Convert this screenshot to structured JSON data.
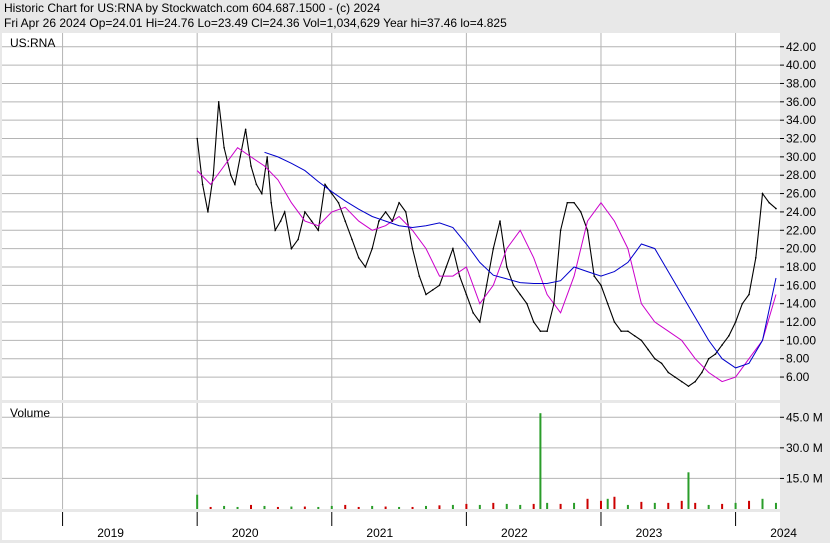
{
  "header": {
    "title": "Historic Chart for US:RNA by Stockwatch.com 604.687.1500 - (c) 2024",
    "summary": "Fri Apr 26 2024   Op=24.01  Hi=24.76  Lo=23.49  Cl=24.36  Vol=1,034,629  Year hi=37.46  lo=4.825"
  },
  "colors": {
    "price": "#000000",
    "ma_short": "#cc00cc",
    "ma_long": "#0000cc",
    "vol_up": "#2a9d2a",
    "vol_down": "#cc0000",
    "grid": "#b4b4b4",
    "panel": "#ffffff",
    "frame": "#e8e8e8"
  },
  "chart_data": [
    {
      "type": "line",
      "panel_label": "US:RNA",
      "y_ticks": [
        "42.00",
        "40.00",
        "38.00",
        "36.00",
        "34.00",
        "32.00",
        "30.00",
        "28.00",
        "26.00",
        "24.00",
        "22.00",
        "20.00",
        "18.00",
        "16.00",
        "14.00",
        "12.00",
        "10.00",
        "8.00",
        "6.00"
      ],
      "ylim": [
        3.5,
        43.5
      ],
      "x_ticks": [
        "2019",
        "2020",
        "2021",
        "2022",
        "2023",
        "2024"
      ],
      "x_tick_values": [
        2019.0,
        2020.0,
        2021.0,
        2022.0,
        2023.0,
        2024.0
      ],
      "xlim": [
        2018.55,
        2024.33
      ],
      "grid": true,
      "series": [
        {
          "role": "price",
          "x": [
            2020.0,
            2020.04,
            2020.08,
            2020.12,
            2020.16,
            2020.2,
            2020.25,
            2020.28,
            2020.32,
            2020.36,
            2020.4,
            2020.44,
            2020.48,
            2020.52,
            2020.55,
            2020.58,
            2020.62,
            2020.65,
            2020.7,
            2020.75,
            2020.8,
            2020.85,
            2020.9,
            2020.95,
            2021.0,
            2021.05,
            2021.1,
            2021.15,
            2021.2,
            2021.25,
            2021.3,
            2021.35,
            2021.4,
            2021.45,
            2021.5,
            2021.55,
            2021.6,
            2021.65,
            2021.7,
            2021.75,
            2021.8,
            2021.85,
            2021.9,
            2021.95,
            2022.0,
            2022.05,
            2022.1,
            2022.15,
            2022.2,
            2022.25,
            2022.3,
            2022.35,
            2022.4,
            2022.45,
            2022.5,
            2022.55,
            2022.6,
            2022.65,
            2022.7,
            2022.75,
            2022.8,
            2022.85,
            2022.9,
            2022.95,
            2023.0,
            2023.05,
            2023.1,
            2023.15,
            2023.2,
            2023.25,
            2023.3,
            2023.35,
            2023.4,
            2023.45,
            2023.5,
            2023.55,
            2023.6,
            2023.65,
            2023.7,
            2023.75,
            2023.8,
            2023.85,
            2023.9,
            2023.95,
            2024.0,
            2024.05,
            2024.1,
            2024.15,
            2024.2,
            2024.25,
            2024.3
          ],
          "values": [
            32,
            27,
            24,
            28,
            36,
            31,
            28,
            27,
            30,
            33,
            29,
            27,
            26,
            30,
            25,
            22,
            23,
            24,
            20,
            21,
            24,
            23,
            22,
            27,
            26,
            25,
            23,
            21,
            19,
            18,
            20,
            23,
            24,
            23,
            25,
            24,
            20,
            17,
            15,
            15.5,
            16,
            18,
            20,
            17,
            15,
            13,
            12,
            16,
            20,
            23,
            18,
            16,
            15,
            14,
            12,
            11,
            11,
            14,
            22,
            25,
            25,
            24,
            22,
            17,
            16,
            14,
            12,
            11,
            11,
            10.5,
            10,
            9,
            8,
            7.5,
            6.5,
            6,
            5.5,
            5,
            5.5,
            6.5,
            8,
            8.5,
            9.5,
            10.5,
            12,
            14,
            15,
            19,
            26,
            25,
            24.36
          ]
        },
        {
          "role": "short_moving_average",
          "x": [
            2020.0,
            2020.1,
            2020.2,
            2020.3,
            2020.4,
            2020.5,
            2020.6,
            2020.7,
            2020.8,
            2020.9,
            2021.0,
            2021.1,
            2021.2,
            2021.3,
            2021.4,
            2021.5,
            2021.6,
            2021.7,
            2021.8,
            2021.9,
            2022.0,
            2022.1,
            2022.2,
            2022.3,
            2022.4,
            2022.5,
            2022.6,
            2022.7,
            2022.8,
            2022.9,
            2023.0,
            2023.1,
            2023.2,
            2023.3,
            2023.4,
            2023.5,
            2023.6,
            2023.7,
            2023.8,
            2023.9,
            2024.0,
            2024.1,
            2024.2,
            2024.3
          ],
          "values": [
            28.5,
            27,
            29,
            31,
            30,
            29,
            27.5,
            25,
            23,
            22.5,
            24,
            24.5,
            23,
            22,
            22.5,
            23.5,
            22,
            20,
            17,
            17,
            18,
            14,
            16,
            20,
            22,
            19,
            15,
            13,
            17,
            23,
            25,
            23,
            20,
            14,
            12,
            11,
            10,
            8,
            6.5,
            5.5,
            6,
            8,
            10,
            15
          ]
        },
        {
          "role": "long_moving_average",
          "x": [
            2020.5,
            2020.6,
            2020.7,
            2020.8,
            2020.9,
            2021.0,
            2021.1,
            2021.2,
            2021.3,
            2021.4,
            2021.5,
            2021.6,
            2021.7,
            2021.8,
            2021.9,
            2022.0,
            2022.1,
            2022.2,
            2022.3,
            2022.4,
            2022.5,
            2022.6,
            2022.7,
            2022.8,
            2022.9,
            2023.0,
            2023.1,
            2023.2,
            2023.3,
            2023.4,
            2023.5,
            2023.6,
            2023.7,
            2023.8,
            2023.9,
            2024.0,
            2024.1,
            2024.2,
            2024.3
          ],
          "values": [
            30.5,
            30,
            29.3,
            28.5,
            27.3,
            26.2,
            25.2,
            24.3,
            23.5,
            23,
            22.5,
            22.3,
            22.5,
            22.8,
            22.3,
            20.5,
            18.5,
            17.1,
            16.7,
            16.3,
            16.2,
            16.2,
            16.5,
            18,
            17.5,
            17,
            17.5,
            18.5,
            20.5,
            20,
            17.5,
            15,
            12.5,
            10,
            8,
            7,
            7.5,
            10,
            16.8
          ]
        }
      ]
    },
    {
      "type": "bar",
      "panel_label": "Volume",
      "y_ticks": [
        "45.0 M",
        "30.0 M",
        "15.0 M"
      ],
      "ylim": [
        0,
        52
      ],
      "series": [
        {
          "name": "",
          "role": "volume",
          "x": [
            2020.0,
            2020.1,
            2020.2,
            2020.3,
            2020.4,
            2020.5,
            2020.6,
            2020.7,
            2020.8,
            2020.9,
            2021.0,
            2021.1,
            2021.2,
            2021.3,
            2021.4,
            2021.5,
            2021.6,
            2021.7,
            2021.8,
            2021.9,
            2022.0,
            2022.1,
            2022.2,
            2022.3,
            2022.4,
            2022.5,
            2022.55,
            2022.6,
            2022.7,
            2022.8,
            2022.9,
            2023.0,
            2023.05,
            2023.1,
            2023.2,
            2023.3,
            2023.4,
            2023.5,
            2023.6,
            2023.65,
            2023.7,
            2023.8,
            2023.9,
            2024.0,
            2024.1,
            2024.2,
            2024.3
          ],
          "values": [
            7,
            1,
            1.5,
            1,
            2,
            1.5,
            1,
            1.2,
            1.2,
            1,
            1.5,
            2,
            1,
            1.5,
            1.2,
            1,
            1,
            1.5,
            1.8,
            2,
            2.5,
            2,
            3,
            2.5,
            2,
            2.5,
            47,
            3,
            2.5,
            3,
            5,
            4,
            5,
            6,
            2,
            3.5,
            3,
            3,
            4,
            18,
            3,
            2,
            2.5,
            3,
            4,
            5,
            3
          ],
          "up": [
            1,
            0,
            1,
            1,
            0,
            1,
            0,
            1,
            0,
            1,
            1,
            0,
            0,
            1,
            0,
            1,
            0,
            1,
            0,
            1,
            0,
            1,
            0,
            1,
            1,
            0,
            1,
            1,
            0,
            1,
            0,
            0,
            1,
            0,
            1,
            0,
            1,
            0,
            0,
            1,
            0,
            1,
            0,
            1,
            0,
            1,
            1
          ]
        }
      ]
    }
  ]
}
